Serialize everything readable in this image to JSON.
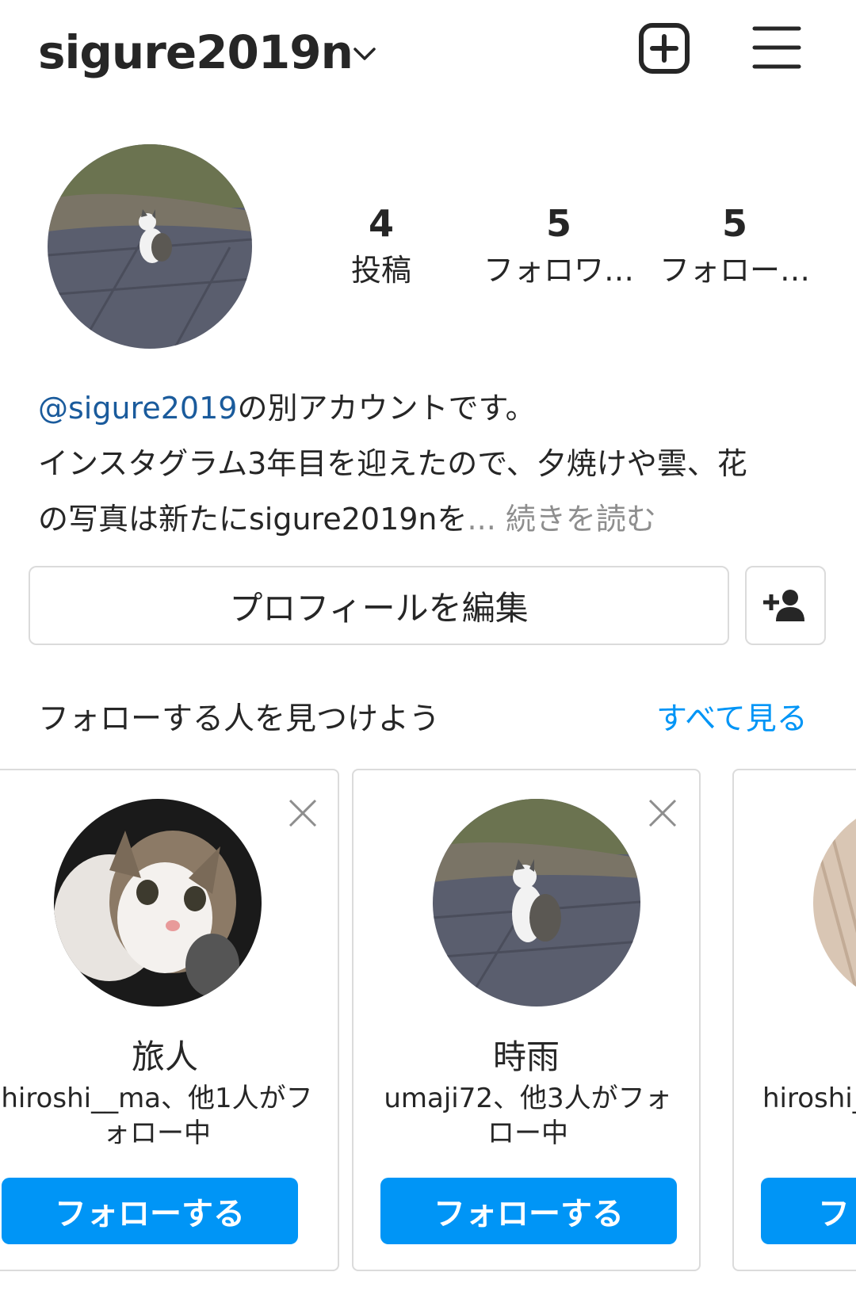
{
  "header": {
    "username": "sigure2019n",
    "icons": [
      "chevron-down-icon",
      "new-post-icon",
      "menu-icon"
    ]
  },
  "stats": {
    "posts_count": "4",
    "posts_label": "投稿",
    "followers_count": "5",
    "followers_label": "フォロワ…",
    "following_count": "5",
    "following_label": "フォロー…"
  },
  "bio": {
    "mention": "@sigure2019",
    "line1_rest": "の別アカウントです。",
    "line2": "インスタグラム3年目を迎えたので、夕焼けや雲、花",
    "line3": "の写真は新たにsigure2019nを",
    "ellipsis": "... ",
    "more": "続きを読む"
  },
  "actions": {
    "edit_profile": "プロフィールを編集",
    "add_person_icon": "add-person-icon"
  },
  "discover": {
    "title": "フォローする人を見つけよう",
    "see_all": "すべて見る",
    "cards": [
      {
        "name": "旅人",
        "sub_line1": "hiroshi__ma、他1人がフ",
        "sub_line2": "ォロー中",
        "button": "フォローする"
      },
      {
        "name": "時雨",
        "sub_line1": "umaji72、他3人がフォ",
        "sub_line2": "ロー中",
        "button": "フォローする"
      },
      {
        "name": "",
        "sub_line1": "hiroshi_",
        "sub_line2": "",
        "button": "フ"
      }
    ]
  },
  "colors": {
    "accent": "#0095f6",
    "link": "#1a5b9c",
    "muted": "#8e8e8e",
    "border": "#dbdbdb"
  }
}
